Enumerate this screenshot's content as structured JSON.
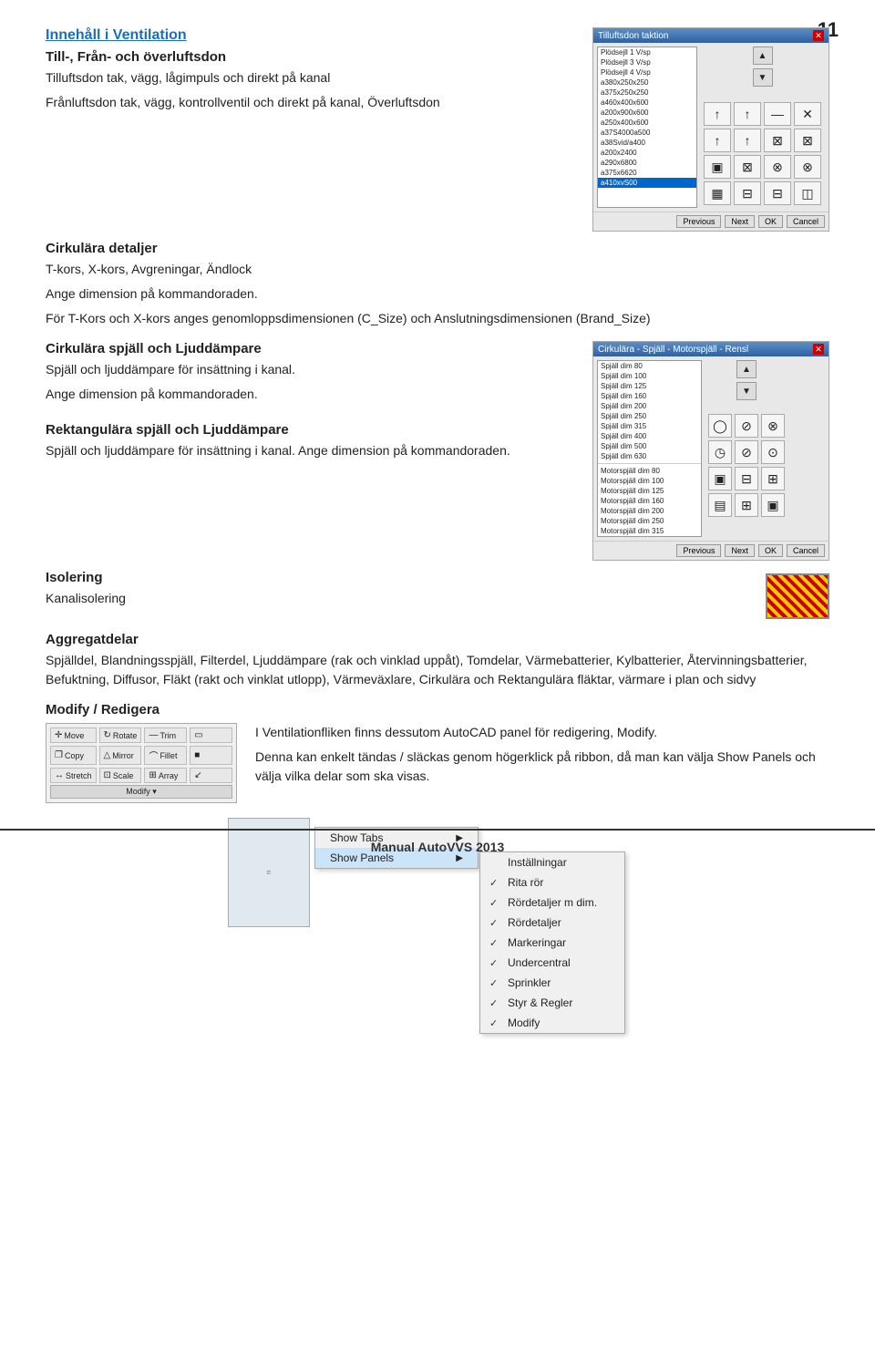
{
  "page": {
    "number": "11",
    "footer": "Manual AutoVVS 2013"
  },
  "heading": {
    "main": "Innehåll i Ventilation",
    "sub1": "Till-, Från- och överluftsdon"
  },
  "section1": {
    "text1": "Tilluftsdon tak, vägg, lågimpuls och direkt på kanal",
    "text2": "Frånluftsdon tak, vägg, kontrollventil och direkt på kanal, Överluftsdon"
  },
  "dialog1": {
    "title": "Tilluftsdon taktion",
    "listItems": [
      "Plödsejll 1 V/sp",
      "Plödsejll 3 V/sp",
      "Plödsejll 4 V/sp",
      "a380x250x250",
      "a375x250x250",
      "a460x400x600",
      "a200x900x600",
      "a250x400x600",
      "a37S4000a500",
      "a38Svid/a400",
      "a200x2400",
      "a290x6800",
      "a375x6620"
    ],
    "selectedItem": "a410xvS00",
    "buttons": [
      "Previous",
      "Next",
      "OK",
      "Cancel"
    ]
  },
  "section2": {
    "heading": "Cirkulära detaljer",
    "text": "T-kors, X-kors, Avgreningar, Ändlock",
    "dimensionText": "Ange dimension på kommandoraden.",
    "xtorsText": "För T-Kors och X-kors anges genomloppsdimensionen (C_Size) och Anslutningsdimensionen (Brand_Size)"
  },
  "section3": {
    "heading": "Cirkulära spjäll och Ljuddämpare",
    "text1": "Spjäll och ljuddämpare för insättning i kanal.",
    "text2": "Ange dimension på kommandoraden."
  },
  "dialog2": {
    "title": "Cirkulära - Spjäll - Motorspjäll - Rensl",
    "spjallItems": [
      "Spjäll dim 80",
      "Spjäll dim 100",
      "Spjäll dim 125",
      "Spjäll dim 160",
      "Spjäll dim 200",
      "Spjäll dim 250",
      "Spjäll dim 315",
      "Spjäll dim 400",
      "Spjäll dim 500",
      "Spjäll dim 630"
    ],
    "motorItems": [
      "Motorspjäll dim 80",
      "Motorspjäll dim 100",
      "Motorspjäll dim 125",
      "Motorspjäll dim 160",
      "Motorspjäll dim 200",
      "Motorspjäll dim 250",
      "Motorspjäll dim 315"
    ],
    "buttons": [
      "Previous",
      "Next",
      "OK",
      "Cancel"
    ]
  },
  "section4": {
    "heading": "Rektangulära spjäll och Ljuddämpare",
    "text": "Spjäll och ljuddämpare för insättning i kanal. Ange dimension på kommandoraden."
  },
  "section5": {
    "heading": "Isolering",
    "text": "Kanalisolering"
  },
  "section6": {
    "heading": "Aggregatdelar",
    "text": "Spjälldel, Blandningsspjäll, Filterdel, Ljuddämpare (rak och vinklad uppåt), Tomdelar, Värmebatterier, Kylbatterier, Återvinningsbatterier, Befuktning, Diffusor, Fläkt (rakt och vinklat utlopp), Värmeväxlare, Cirkulära och Rektangulära fläktar, värmare i plan och sidvy"
  },
  "section7": {
    "heading": "Modify / Redigera",
    "modifyPanel": {
      "items": [
        {
          "icon": "✛",
          "label": "Move"
        },
        {
          "icon": "↻",
          "label": "Rotate"
        },
        {
          "icon": "—/—",
          "label": "Trim"
        },
        {
          "icon": "▭",
          "label": ""
        },
        {
          "icon": "❐",
          "label": "Copy"
        },
        {
          "icon": "△",
          "label": "Mirror"
        },
        {
          "icon": "⌒",
          "label": "Fillet"
        },
        {
          "icon": "■",
          "label": ""
        },
        {
          "icon": "↔",
          "label": "Stretch"
        },
        {
          "icon": "⊡",
          "label": "Scale"
        },
        {
          "icon": "⊞",
          "label": "Array"
        },
        {
          "icon": "↙",
          "label": ""
        }
      ],
      "footerLabel": "Modify ▾"
    },
    "text1": "I Ventilationfliken finns dessutom AutoCAD panel för redigering, Modify.",
    "text2": "Denna kan enkelt tändas / släckas genom högerklick på ribbon, då man kan välja Show Panels och välja vilka delar som ska visas."
  },
  "contextMenu": {
    "items": [
      {
        "label": "Show Tabs",
        "hasArrow": true
      },
      {
        "label": "Show Panels",
        "hasArrow": true
      }
    ],
    "submenu": {
      "items": [
        {
          "label": "Inställningar",
          "checked": false
        },
        {
          "label": "Rita rör",
          "checked": true
        },
        {
          "label": "Rördetaljer m dim.",
          "checked": true
        },
        {
          "label": "Rördetaljer",
          "checked": true
        },
        {
          "label": "Markeringar",
          "checked": true
        },
        {
          "label": "Undercentral",
          "checked": true
        },
        {
          "label": "Sprinkler",
          "checked": true
        },
        {
          "label": "Styr & Regler",
          "checked": true
        },
        {
          "label": "Modify",
          "checked": true
        }
      ]
    }
  }
}
